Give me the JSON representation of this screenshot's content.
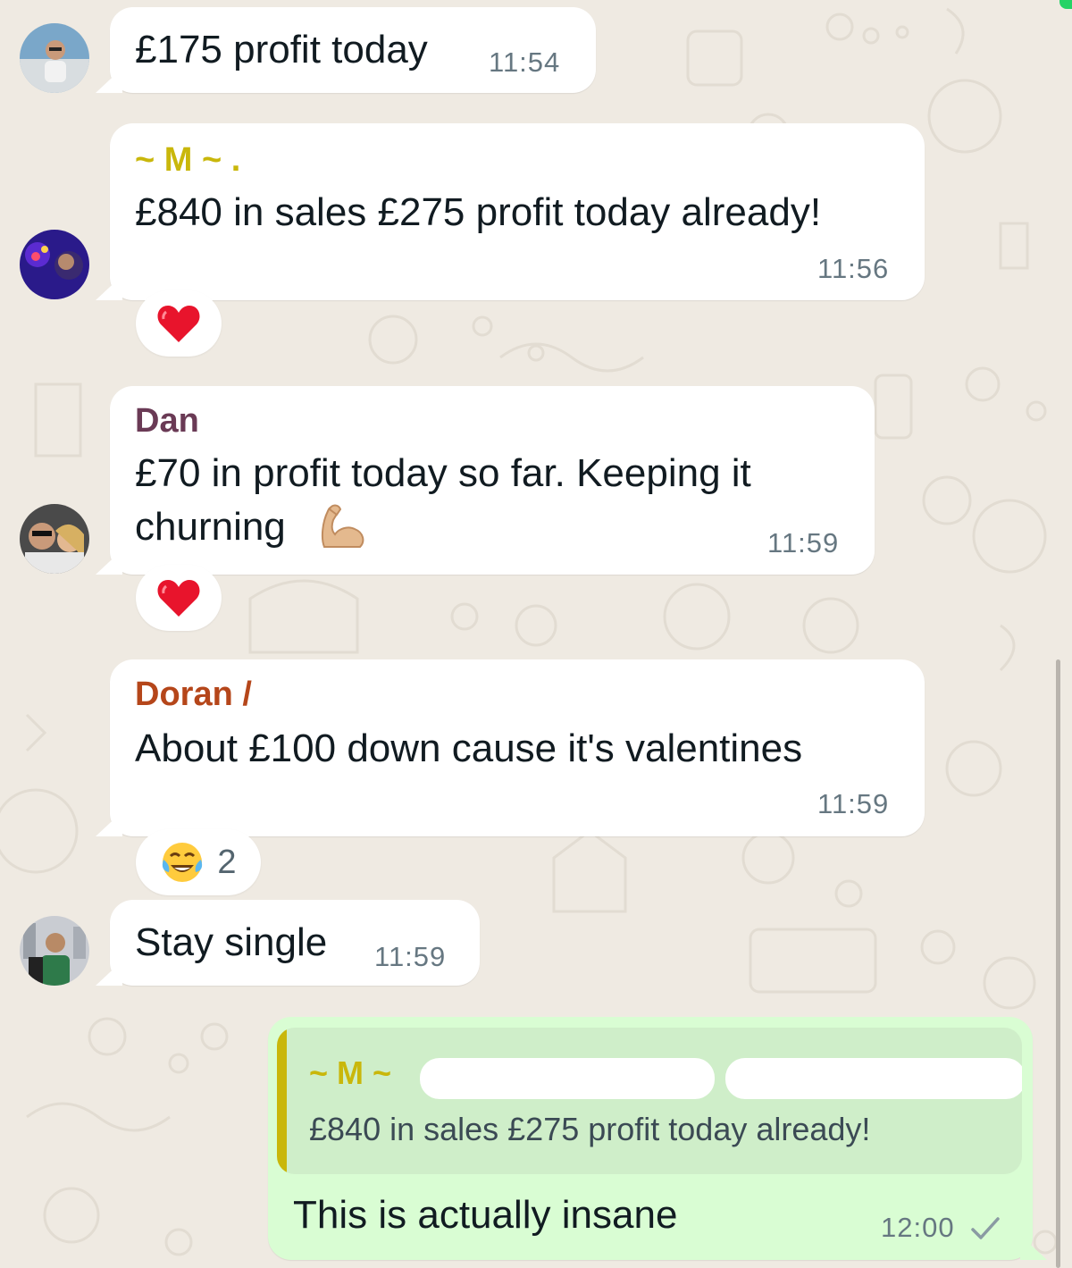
{
  "messages": [
    {
      "text": "£175 profit today",
      "time": "11:54"
    },
    {
      "sender": "~ M ~ .",
      "text": "£840 in sales £275 profit today already!",
      "time": "11:56",
      "reaction": "heart"
    },
    {
      "sender": "Dan",
      "text_line1": "£70 in profit today so far. Keeping it",
      "text_line2": "churning",
      "emoji": "flexed-biceps",
      "time": "11:59",
      "reaction": "heart"
    },
    {
      "sender": "Doran /",
      "text": "About £100 down cause it's valentines",
      "time": "11:59",
      "reaction": "joy",
      "reaction_count": "2"
    },
    {
      "text": "Stay single",
      "time": "11:59"
    }
  ],
  "outgoing": {
    "quote_sender": "~ M ~",
    "quote_text": "£840 in sales £275 profit today already!",
    "text": "This is actually insane",
    "time": "12:00",
    "status": "sent-check"
  },
  "colors": {
    "background": "#efeae2",
    "bubble_in": "#ffffff",
    "bubble_out": "#d9fdd3",
    "sender_m": "#c9b70b",
    "sender_dan": "#6a3a55",
    "sender_doran": "#b5461a",
    "timestamp": "#667781"
  }
}
